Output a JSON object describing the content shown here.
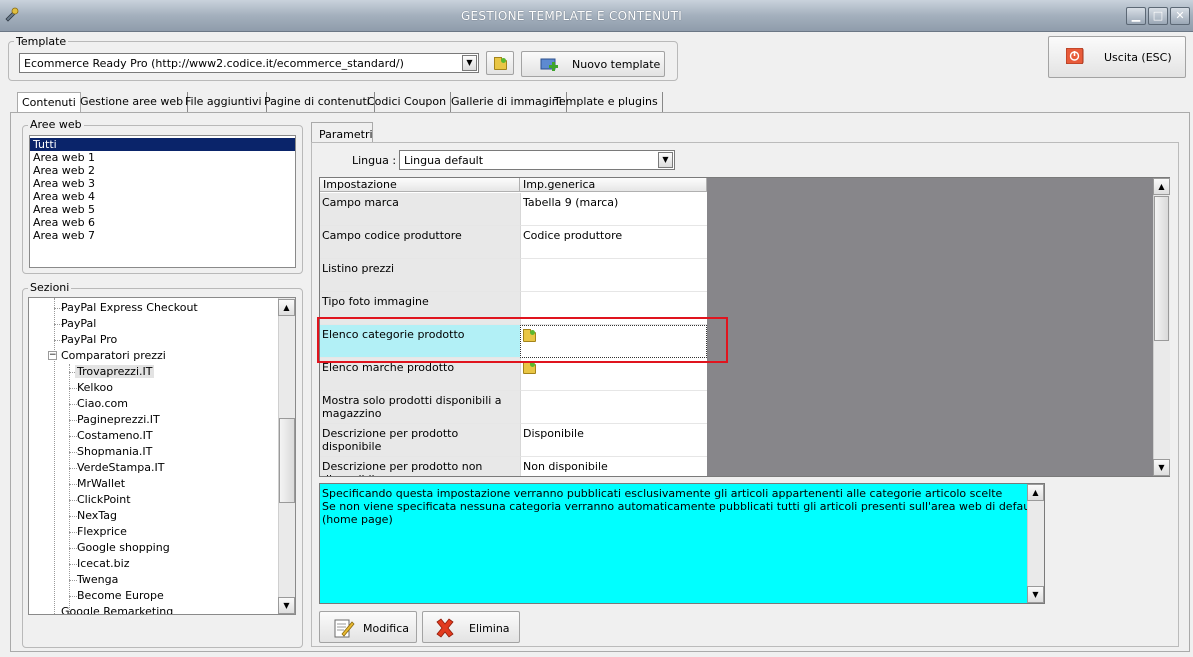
{
  "window": {
    "title": "GESTIONE TEMPLATE E CONTENUTI"
  },
  "template": {
    "group_label": "Template",
    "selected": "Ecommerce Ready Pro (http://www2.codice.it/ecommerce_standard/)",
    "new_button": "Nuovo template",
    "exit_button": "Uscita (ESC)"
  },
  "tabs": [
    "Contenuti",
    "Gestione aree web",
    "File aggiuntivi",
    "Pagine di contenuti",
    "Codici Coupon",
    "Gallerie di immagini",
    "Template e plugins"
  ],
  "aree_web": {
    "label": "Aree web",
    "items": [
      "Tutti",
      "Area web 1",
      "Area web 2",
      "Area web 3",
      "Area web 4",
      "Area web 5",
      "Area web 6",
      "Area web 7"
    ]
  },
  "sezioni": {
    "label": "Sezioni",
    "items": [
      "PayPal Express Checkout",
      "PayPal",
      "PayPal Pro",
      "Comparatori prezzi",
      "Trovaprezzi.IT",
      "Kelkoo",
      "Ciao.com",
      "Pagineprezzi.IT",
      "Costameno.IT",
      "Shopmania.IT",
      "VerdeStampa.IT",
      "MrWallet",
      "ClickPoint",
      "NexTag",
      "Flexprice",
      "Google shopping",
      "Icecat.biz",
      "Twenga",
      "Become Europe",
      "Google Remarketing"
    ],
    "collapse_glyph": "−"
  },
  "parametri": {
    "tab_label": "Parametri",
    "lingua_label": "Lingua :",
    "lingua_value": "Lingua default",
    "col1": "Impostazione",
    "col2": "Imp.generica",
    "rows": [
      {
        "key": "Campo marca",
        "val": "Tabella 9 (marca)"
      },
      {
        "key": "Campo codice produttore",
        "val": "Codice produttore"
      },
      {
        "key": "Listino prezzi",
        "val": ""
      },
      {
        "key": "Tipo foto immagine",
        "val": ""
      },
      {
        "key": "Elenco categorie prodotto",
        "val": ""
      },
      {
        "key": "Elenco marche prodotto",
        "val": ""
      },
      {
        "key": "Mostra solo prodotti disponibili a magazzino",
        "val": ""
      },
      {
        "key": "Descrizione per prodotto disponibile",
        "val": "Disponibile"
      },
      {
        "key": "Descrizione per prodotto non disponibile",
        "val": "Non disponibile"
      }
    ]
  },
  "description": {
    "line1": "Specificando questa impostazione verranno pubblicati esclusivamente gli articoli appartenenti alle categorie articolo scelte",
    "line2": "Se non viene specificata nessuna categoria verranno automaticamente pubblicati tutti gli articoli presenti sull'area web di default (home page)"
  },
  "actions": {
    "modifica": "Modifica",
    "elimina": "Elimina"
  },
  "colors": {
    "highlight_row": "#b2f0f6",
    "description_bg": "#00ffff",
    "highlight_box": "#e0141e"
  }
}
